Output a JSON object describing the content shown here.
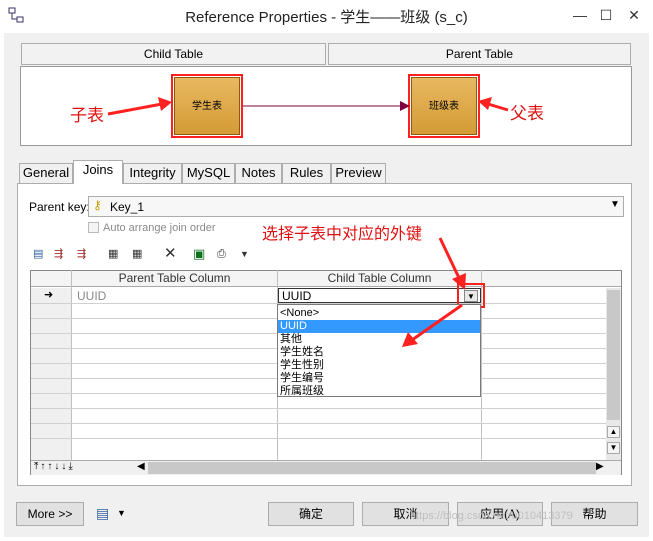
{
  "window": {
    "title": "Reference Properties - 学生——班级 (s_c)",
    "minimize": "—",
    "maximize": "☐",
    "close": "✕"
  },
  "header": {
    "child_table": "Child Table",
    "parent_table": "Parent Table"
  },
  "diagram": {
    "child_entity": "学生表",
    "parent_entity": "班级表",
    "child_annotation": "子表",
    "parent_annotation": "父表"
  },
  "tabs": [
    {
      "label": "General"
    },
    {
      "label": "Joins"
    },
    {
      "label": "Integrity"
    },
    {
      "label": "MySQL"
    },
    {
      "label": "Notes"
    },
    {
      "label": "Rules"
    },
    {
      "label": "Preview"
    }
  ],
  "joins": {
    "parent_key_label": "Parent key:",
    "parent_key_value": "Key_1",
    "auto_arrange_label": "Auto arrange join order",
    "annotation": "选择子表中对应的外键",
    "columns": {
      "parent": "Parent Table Column",
      "child": "Child Table Column"
    },
    "row1": {
      "marker": "➜",
      "parent": "UUID",
      "child": "UUID"
    },
    "dropdown_options": [
      "<None>",
      "UUID",
      "其他",
      "学生姓名",
      "学生性别",
      "学生编号",
      "所属班级"
    ],
    "selected_option": "UUID"
  },
  "buttons": {
    "more": "More >>",
    "ok": "确定",
    "cancel": "取消",
    "apply": "应用(A)",
    "help": "帮助"
  },
  "watermark": "https://blog.csdn.net/u010413379",
  "colors": {
    "accent_red": "#ff2020",
    "selection": "#3399ff",
    "entity_fill": "#d49b36"
  }
}
